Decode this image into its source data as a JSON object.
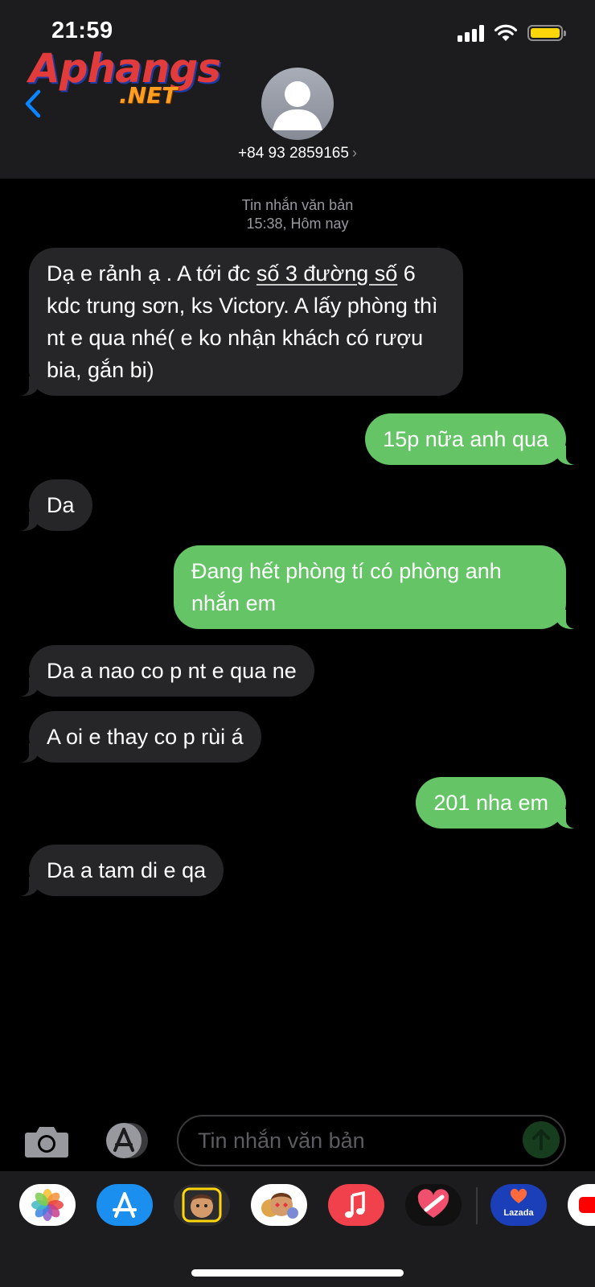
{
  "status": {
    "time": "21:59"
  },
  "logo": {
    "line1": "Aphangs",
    "line2": ".NET"
  },
  "contact": {
    "number": "+84 93 2859165",
    "chevron": "›"
  },
  "thread_meta": {
    "type": "Tin nhắn văn bản",
    "time": "15:38, Hôm nay"
  },
  "messages": [
    {
      "dir": "in",
      "parts": [
        " Dạ e rảnh ạ . A tới đc ",
        "số 3 đường số",
        " 6 kdc trung sơn, ks Victory. A lấy phòng thì nt e qua nhé( e ko nhận khách có rượu bia, gắn bi)"
      ]
    },
    {
      "dir": "out",
      "text": "15p nữa anh qua"
    },
    {
      "dir": "in",
      "text": "Da"
    },
    {
      "dir": "out",
      "text": "Đang hết phòng tí có phòng anh nhắn em"
    },
    {
      "dir": "in",
      "text": "Da a nao co p nt e qua ne"
    },
    {
      "dir": "in",
      "text": "A oi e thay co p rùi á "
    },
    {
      "dir": "out",
      "text": "201 nha em"
    },
    {
      "dir": "in",
      "text": "Da a tam di e qa"
    }
  ],
  "composer": {
    "placeholder": "Tin nhắn văn bản"
  },
  "dock": {
    "apps": [
      "photos-app",
      "app-store-app",
      "memoji-app",
      "memoji-stickers-app",
      "music-app",
      "digital-touch-app",
      "lazada-app",
      "youtube-app"
    ],
    "lazada_label": "Lazada"
  },
  "colors": {
    "outgoing": "#65c466",
    "incoming": "#262629",
    "battery": "#ffd60a",
    "back": "#0a84ff"
  }
}
